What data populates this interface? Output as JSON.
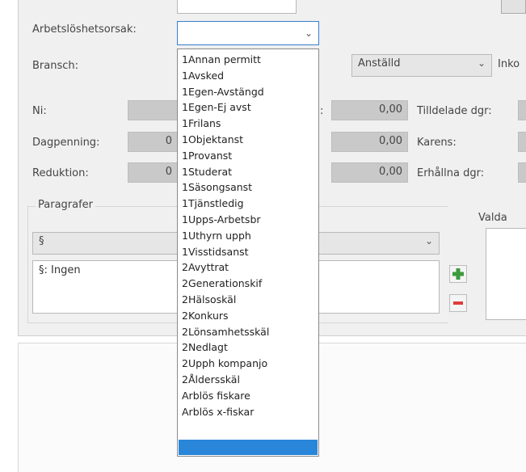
{
  "colors": {
    "accent": "#2a86d9",
    "plus": "#3c9a3c",
    "minus": "#e03b3b"
  },
  "form": {
    "reason_label": "Arbetslöshetsorsak:",
    "branch_label": "Bransch:",
    "employment_value": "Anställd",
    "inko_label": "Inko",
    "ni_label": "Ni:",
    "daily_label": "Dagpenning:",
    "daily_partial": "0",
    "reduction_label": "Reduktion:",
    "reduction_partial": "0",
    "colon_fragment": ":",
    "value_a": "0,00",
    "value_b": "0,00",
    "value_c": "0,00",
    "assigned_label": "Tilldelade dgr:",
    "waiting_label": "Karens:",
    "received_label": "Erhållna dgr:"
  },
  "paragraphs": {
    "group_label": "Paragrafer",
    "select_value": "§",
    "text_value": "§: Ingen",
    "chosen_label": "Valda"
  },
  "dropdown": {
    "items": [
      "1Annan permitt",
      "1Avsked",
      "1Egen-Avstängd",
      "1Egen-Ej avst",
      "1Frilans",
      "1Objektanst",
      "1Provanst",
      "1Studerat",
      "1Säsongsanst",
      "1Tjänstledig",
      "1Upps-Arbetsbr",
      "1Uthyrn upph",
      "1Visstidsanst",
      "2Avyttrat",
      "2Generationskif",
      "2Hälsoskäl",
      "2Konkurs",
      "2Lönsamhetsskäl",
      "2Nedlagt",
      "2Upph kompanjo",
      "2Åldersskäl",
      "Arblös fiskare",
      "Arblös x-fiskar"
    ]
  }
}
